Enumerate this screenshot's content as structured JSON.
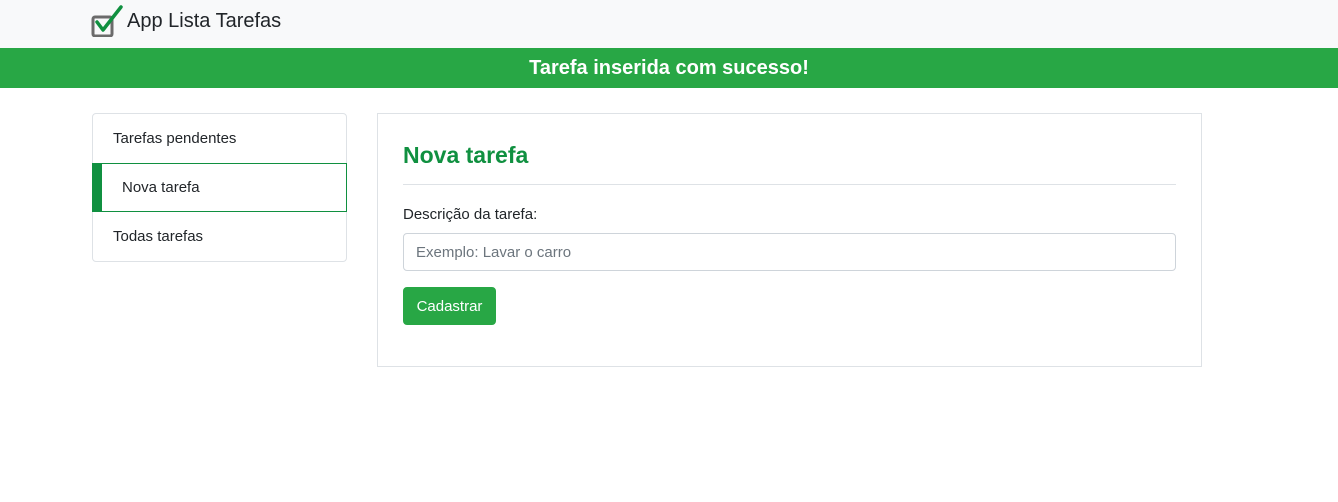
{
  "navbar": {
    "brand_text": "App Lista Tarefas",
    "logo_icon": "checkbox-check-icon"
  },
  "alert": {
    "message": "Tarefa inserida com sucesso!",
    "color": "#28a745"
  },
  "menu": {
    "items": [
      {
        "label": "Tarefas pendentes",
        "active": false
      },
      {
        "label": "Nova tarefa",
        "active": true
      },
      {
        "label": "Todas tarefas",
        "active": false
      }
    ],
    "accent": "#109040"
  },
  "form": {
    "title": "Nova tarefa",
    "field_label": "Descrição da tarefa:",
    "input_value": "",
    "input_placeholder": "Exemplo: Lavar o carro",
    "submit_label": "Cadastrar"
  }
}
